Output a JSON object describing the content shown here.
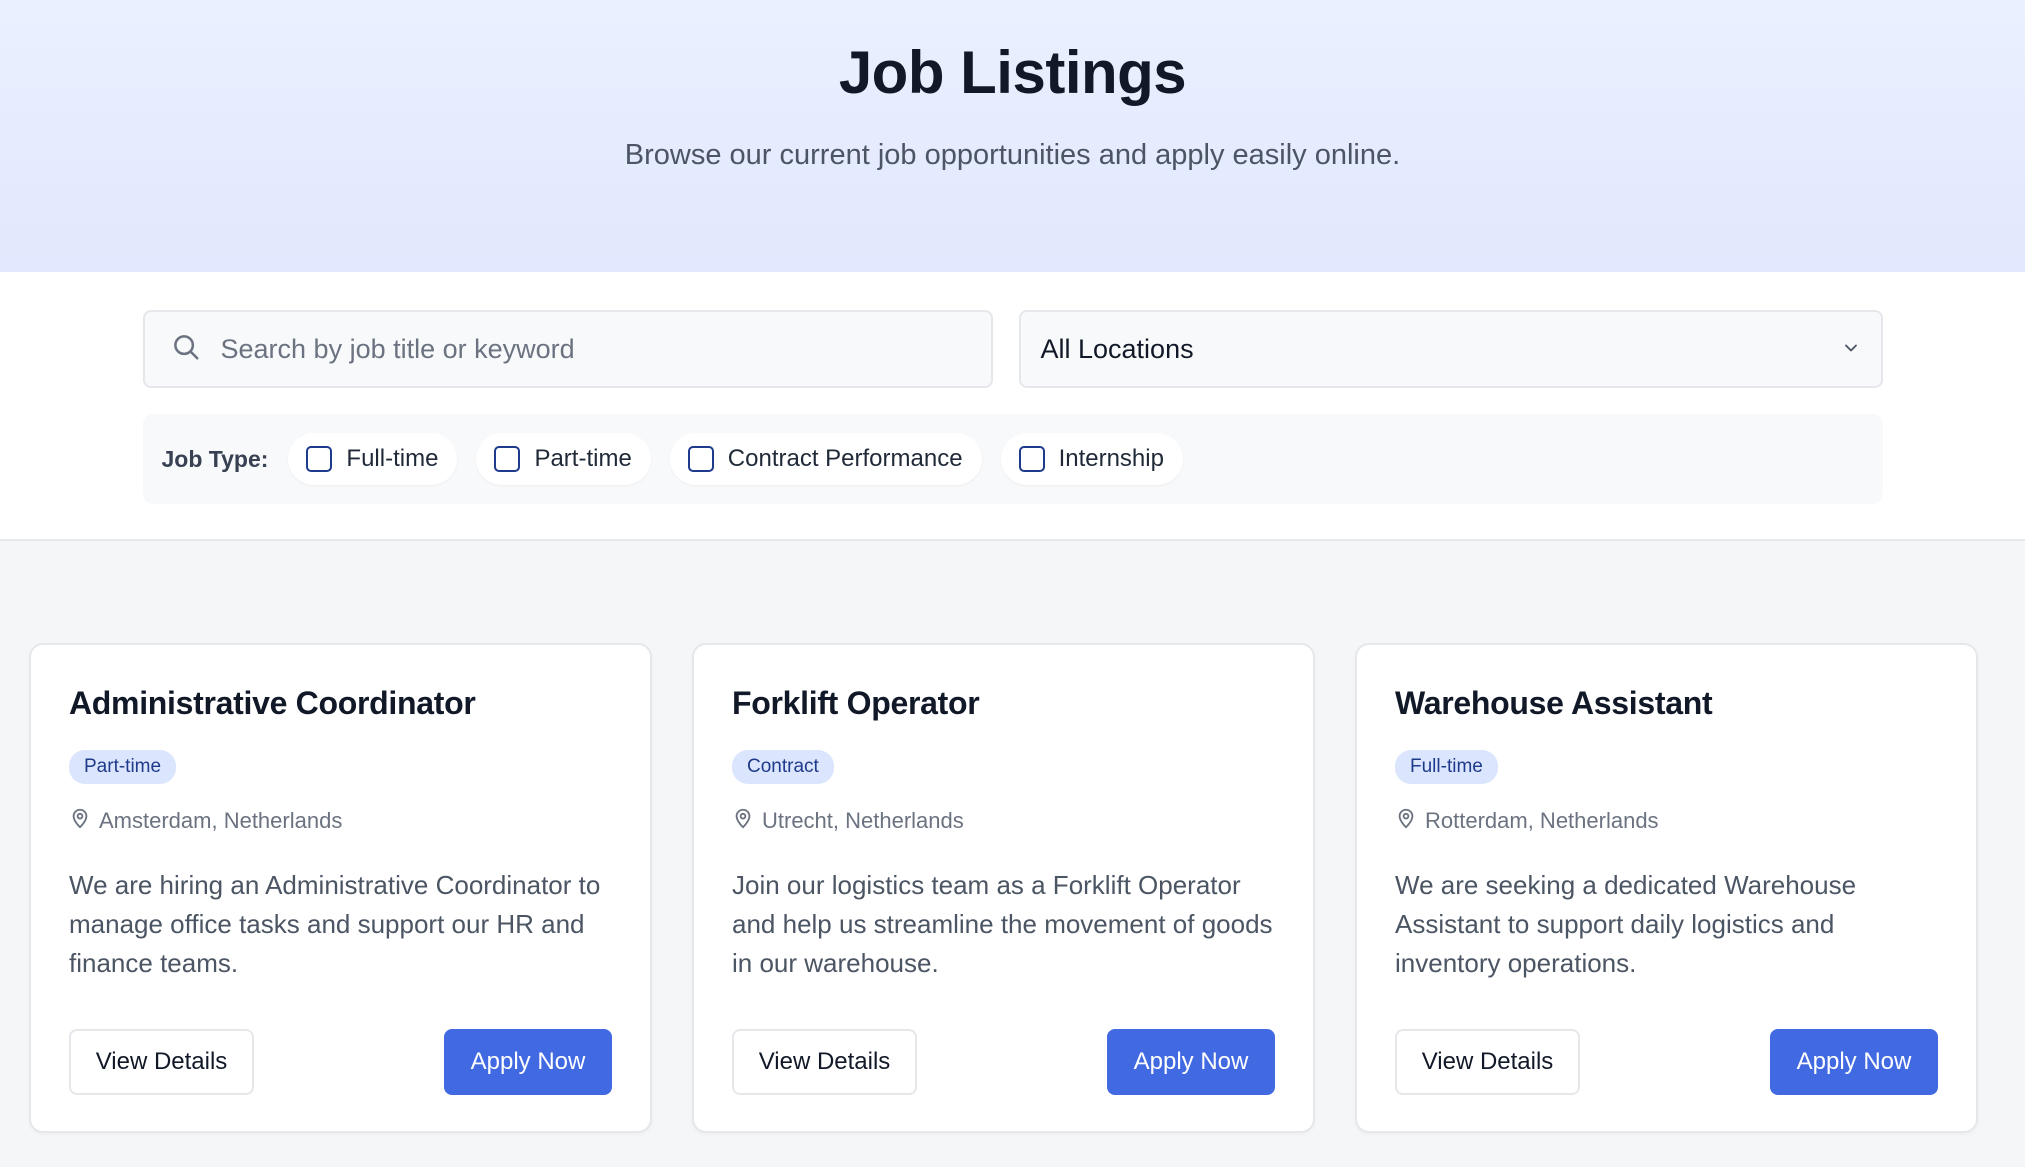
{
  "header": {
    "title": "Job Listings",
    "subtitle": "Browse our current job opportunities and apply easily online."
  },
  "search": {
    "placeholder": "Search by job title or keyword",
    "value": "",
    "icon": "search-icon"
  },
  "location_select": {
    "selected": "All Locations",
    "icon": "chevron-down-icon"
  },
  "job_type": {
    "label": "Job Type:",
    "options": [
      {
        "label": "Full-time",
        "checked": false
      },
      {
        "label": "Part-time",
        "checked": false
      },
      {
        "label": "Contract Performance",
        "checked": false
      },
      {
        "label": "Internship",
        "checked": false
      }
    ]
  },
  "jobs": [
    {
      "title": "Administrative Coordinator",
      "type": "Part-time",
      "location": "Amsterdam, Netherlands",
      "description": "We are hiring an Administrative Coordinator to manage office tasks and support our HR and finance teams.",
      "details_label": "View Details",
      "apply_label": "Apply Now"
    },
    {
      "title": "Forklift Operator",
      "type": "Contract",
      "location": "Utrecht, Netherlands",
      "description": "Join our logistics team as a Forklift Operator and help us streamline the movement of goods in our warehouse.",
      "details_label": "View Details",
      "apply_label": "Apply Now"
    },
    {
      "title": "Warehouse Assistant",
      "type": "Full-time",
      "location": "Rotterdam, Netherlands",
      "description": "We are seeking a dedicated Warehouse Assistant to support daily logistics and inventory operations.",
      "details_label": "View Details",
      "apply_label": "Apply Now"
    }
  ],
  "colors": {
    "accent": "#4169e1",
    "badge_bg": "#dbe5fd",
    "badge_text": "#1e3a8a",
    "hero_bg": "#e6ecfe"
  }
}
